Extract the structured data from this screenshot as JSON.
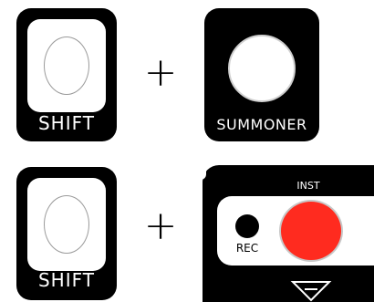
{
  "row1": {
    "modifier_key": {
      "label": "SHIFT"
    },
    "plus_sign": "+",
    "target_key": {
      "label": "SUMMONER"
    }
  },
  "row2": {
    "modifier_key": {
      "label": "SHIFT"
    },
    "plus_sign": "+",
    "panel": {
      "rec_label": "REC",
      "inst_label": "INST",
      "inst_button_color": "#ff2b1f",
      "icon": "triangle-down-icon"
    }
  },
  "colors": {
    "key_body": "#000000",
    "key_face": "#ffffff",
    "accent_red": "#ff2b1f"
  }
}
